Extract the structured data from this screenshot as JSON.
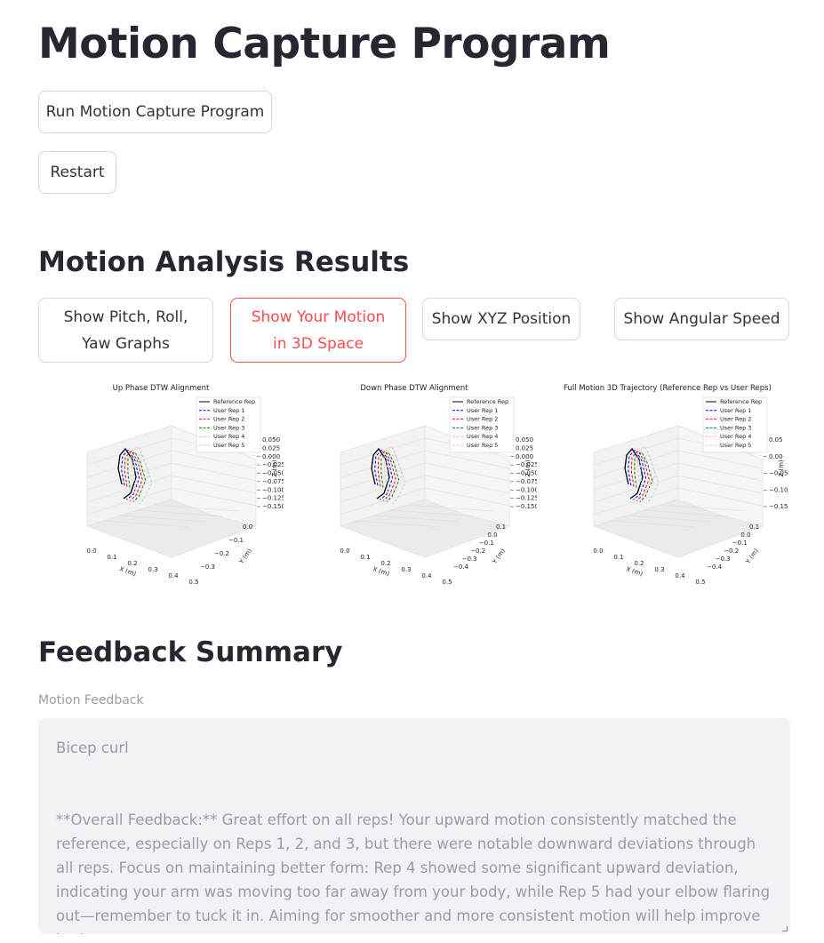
{
  "page": {
    "title": "Motion Capture Program"
  },
  "actions": {
    "run_label": "Run Motion Capture Program",
    "restart_label": "Restart"
  },
  "analysis": {
    "heading": "Motion Analysis Results",
    "tabs": [
      {
        "label": "Show Pitch, Roll, Yaw Graphs",
        "active": false
      },
      {
        "label": "Show Your Motion in 3D Space",
        "active": true
      },
      {
        "label": "Show XYZ Position",
        "active": false
      },
      {
        "label": "Show Angular Speed",
        "active": false
      }
    ]
  },
  "chart_data": [
    {
      "type": "line",
      "title": "Up Phase DTW Alignment",
      "xlabel": "X (m)",
      "ylabel": "Y (m)",
      "zlabel": "Z (m)",
      "x_ticks": [
        "0.0",
        "0.1",
        "0.2",
        "0.3",
        "0.4",
        "0.5"
      ],
      "y_ticks": [
        "0.0",
        "−0.1",
        "−0.2",
        "−0.3"
      ],
      "z_ticks": [
        "0.050",
        "0.025",
        "0.000",
        "−0.025",
        "−0.050",
        "−0.075",
        "−0.100",
        "−0.125",
        "−0.150"
      ],
      "legend": [
        "Reference Rep",
        "User Rep 1",
        "User Rep 2",
        "User Rep 3",
        "User Rep 4",
        "User Rep 5"
      ],
      "colors": [
        "#000000",
        "#0000ff",
        "#ff0000",
        "#008000",
        "#ffb6c1",
        "#add8e6"
      ]
    },
    {
      "type": "line",
      "title": "Down Phase DTW Alignment",
      "xlabel": "X (m)",
      "ylabel": "Y (m)",
      "zlabel": "Z (m)",
      "x_ticks": [
        "0.0",
        "0.1",
        "0.2",
        "0.3",
        "0.4",
        "0.5"
      ],
      "y_ticks": [
        "0.1",
        "0.0",
        "−0.1",
        "−0.2",
        "−0.3",
        "−0.4"
      ],
      "z_ticks": [
        "0.050",
        "0.025",
        "0.000",
        "−0.025",
        "−0.050",
        "−0.075",
        "−0.100",
        "−0.125",
        "−0.150"
      ],
      "legend": [
        "Reference Rep",
        "User Rep 1",
        "User Rep 2",
        "User Rep 3",
        "User Rep 4",
        "User Rep 5"
      ],
      "colors": [
        "#000000",
        "#0000ff",
        "#ff0000",
        "#008000",
        "#ffb6c1",
        "#add8e6"
      ]
    },
    {
      "type": "line",
      "title": "Full Motion 3D Trajectory (Reference Rep vs User Reps)",
      "xlabel": "X (m)",
      "ylabel": "Y (m)",
      "zlabel": "Z (m)",
      "x_ticks": [
        "0.0",
        "0.1",
        "0.2",
        "0.3",
        "0.4",
        "0.5"
      ],
      "y_ticks": [
        "0.1",
        "0.0",
        "−0.1",
        "−0.2",
        "−0.3",
        "−0.4"
      ],
      "z_ticks": [
        "0.05",
        "0.00",
        "−0.05",
        "−0.10",
        "−0.15"
      ],
      "legend": [
        "Reference Rep",
        "User Rep 1",
        "User Rep 2",
        "User Rep 3",
        "User Rep 4",
        "User Rep 5"
      ],
      "colors": [
        "#000000",
        "#0000ff",
        "#ff0000",
        "#008000",
        "#ffb6c1",
        "#add8e6"
      ]
    }
  ],
  "feedback": {
    "heading": "Feedback Summary",
    "label": "Motion Feedback",
    "text": "Bicep curl\n\n\n**Overall Feedback:** Great effort on all reps! Your upward motion consistently matched the reference, especially on Reps 1, 2, and 3, but there were notable downward deviations through all reps. Focus on maintaining better form: Rep 4 showed some significant upward deviation, indicating your arm was moving too far away from your body, while Rep 5 had your elbow flaring out—remember to tuck it in. Aiming for smoother and more consistent motion will help improve both"
  }
}
